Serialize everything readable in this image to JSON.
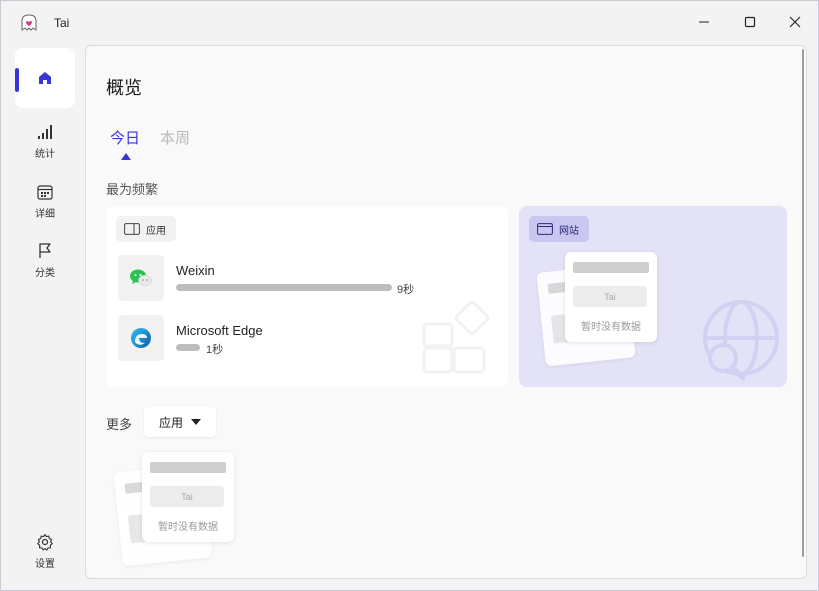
{
  "window": {
    "title": "Tai",
    "controls": {
      "minimize": "minimize-icon",
      "maximize": "maximize-icon",
      "close": "close-icon"
    }
  },
  "sidebar": {
    "items": [
      {
        "id": "home",
        "label": "",
        "icon": "home-icon",
        "active": true
      },
      {
        "id": "stats",
        "label": "统计",
        "icon": "signal-bars-icon"
      },
      {
        "id": "detail",
        "label": "详细",
        "icon": "calendar-icon"
      },
      {
        "id": "category",
        "label": "分类",
        "icon": "flag-icon"
      },
      {
        "id": "settings",
        "label": "设置",
        "icon": "gear-icon"
      }
    ]
  },
  "main": {
    "title": "概览",
    "tabs": [
      {
        "label": "今日",
        "active": true
      },
      {
        "label": "本周",
        "active": false
      }
    ],
    "frequent_label": "最为频繁",
    "app_card": {
      "chip_label": "应用",
      "items": [
        {
          "name": "Weixin",
          "duration": "9秒",
          "icon": "weixin-icon"
        },
        {
          "name": "Microsoft Edge",
          "duration": "1秒",
          "icon": "edge-icon"
        }
      ]
    },
    "web_card": {
      "chip_label": "网站"
    },
    "empty_state": {
      "logo_text": "Tai",
      "message": "暂时没有数据"
    },
    "more": {
      "label": "更多",
      "selected": "应用"
    }
  },
  "colors": {
    "accent": "#3a35d6",
    "web_card_bg": "#e3e2f6",
    "bar": "#bdbdbd"
  }
}
